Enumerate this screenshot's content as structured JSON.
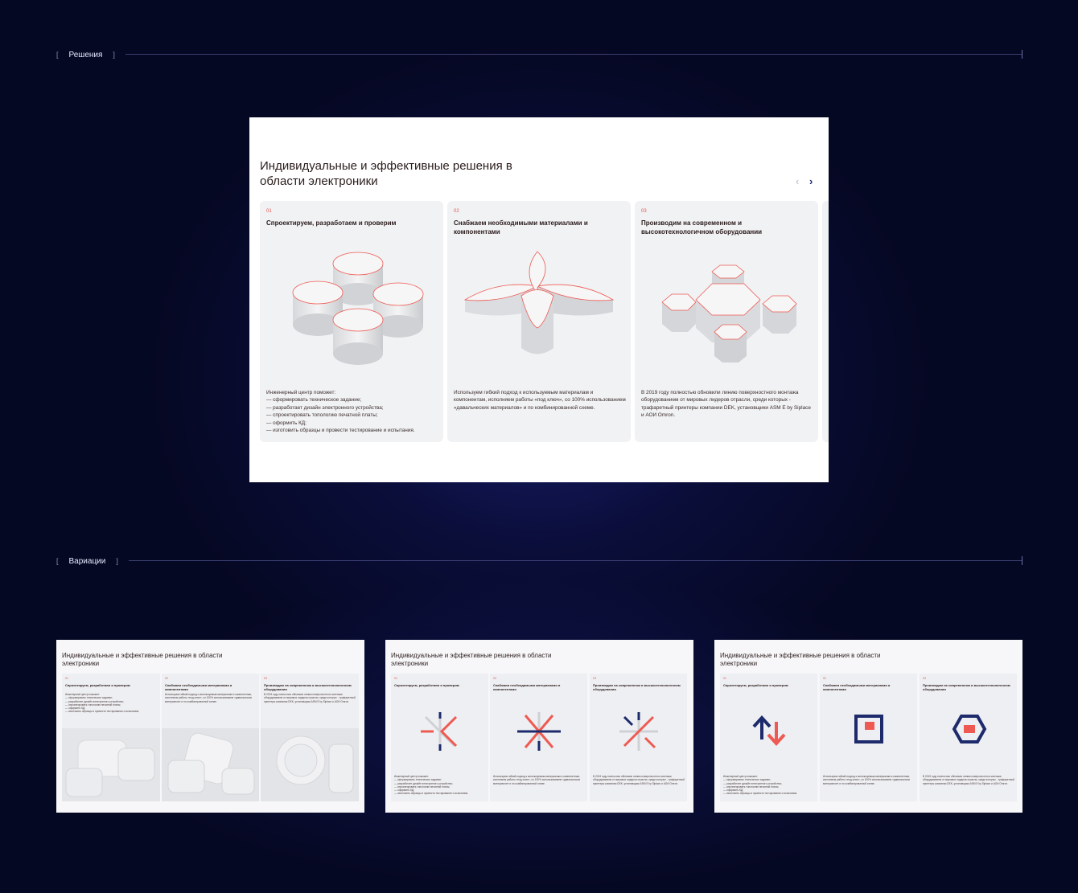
{
  "sections": {
    "solutions_label": "Решения",
    "variations_label": "Вариации",
    "bracket_open": "[",
    "bracket_close": "]"
  },
  "slide": {
    "title": "Индивидуальные и эффективные решения в области электроники",
    "nav_prev": "‹",
    "nav_next": "›",
    "cards": [
      {
        "num": "01",
        "title": "Спроектируем, разработаем и проверим",
        "text": "Инженерный центр поможет:\n— сформировать техническое задание;\n— разработает дизайн электронного устройства;\n— спроектировать топологию печатной платы;\n— оформить КД;\n— изготовить образцы и провести тестирование и испытания."
      },
      {
        "num": "02",
        "title": "Снабжаем необходимыми материалами и компонентами",
        "text": "Используем гибкий подход к используемым материалам и компонентам, исполняем работы «под ключ», со 100% использованием «давальческих материалов» и по комбинированной схеме."
      },
      {
        "num": "03",
        "title": "Производим на современном и высокотехнологичном оборудовании",
        "text": "В 2019 году полностью обновили линию поверхностного монтажа оборудованием от мировых лидеров отрасли, среди которых - трафаретный принтеры компании DEK, установщики ASM E by Siplace и АОИ Omron."
      }
    ]
  },
  "variations": {
    "title": "Индивидуальные и эффективные решения в области электроники",
    "cards": [
      {
        "num": "01",
        "title": "Спроектируем, разработаем и проверим",
        "text": "Инженерный центр поможет:\n— сформировать техническое задание;\n— разработает дизайн электронного устройства;\n— спроектировать топологию печатной платы;\n— оформить КД;\n— изготовить образцы и провести тестирование и испытания."
      },
      {
        "num": "02",
        "title": "Снабжаем необходимыми материалами и компонентами",
        "text": "Используем гибкий подход к используемым материалам и компонентам, исполняем работы «под ключ», со 100% использованием «давальческих материалов» и по комбинированной схеме."
      },
      {
        "num": "03",
        "title": "Производим на современном и высокотехнологичном оборудовании",
        "text": "В 2019 году полностью обновили линию поверхностного монтажа оборудованием от мировых лидеров отрасли, среди которых - трафаретный принтеры компании DEK, установщики ASM E by Siplace и АОИ Omron."
      }
    ]
  },
  "colors": {
    "background": "#050822",
    "accent_red": "#ee5a52",
    "navy": "#1d2a6b"
  }
}
